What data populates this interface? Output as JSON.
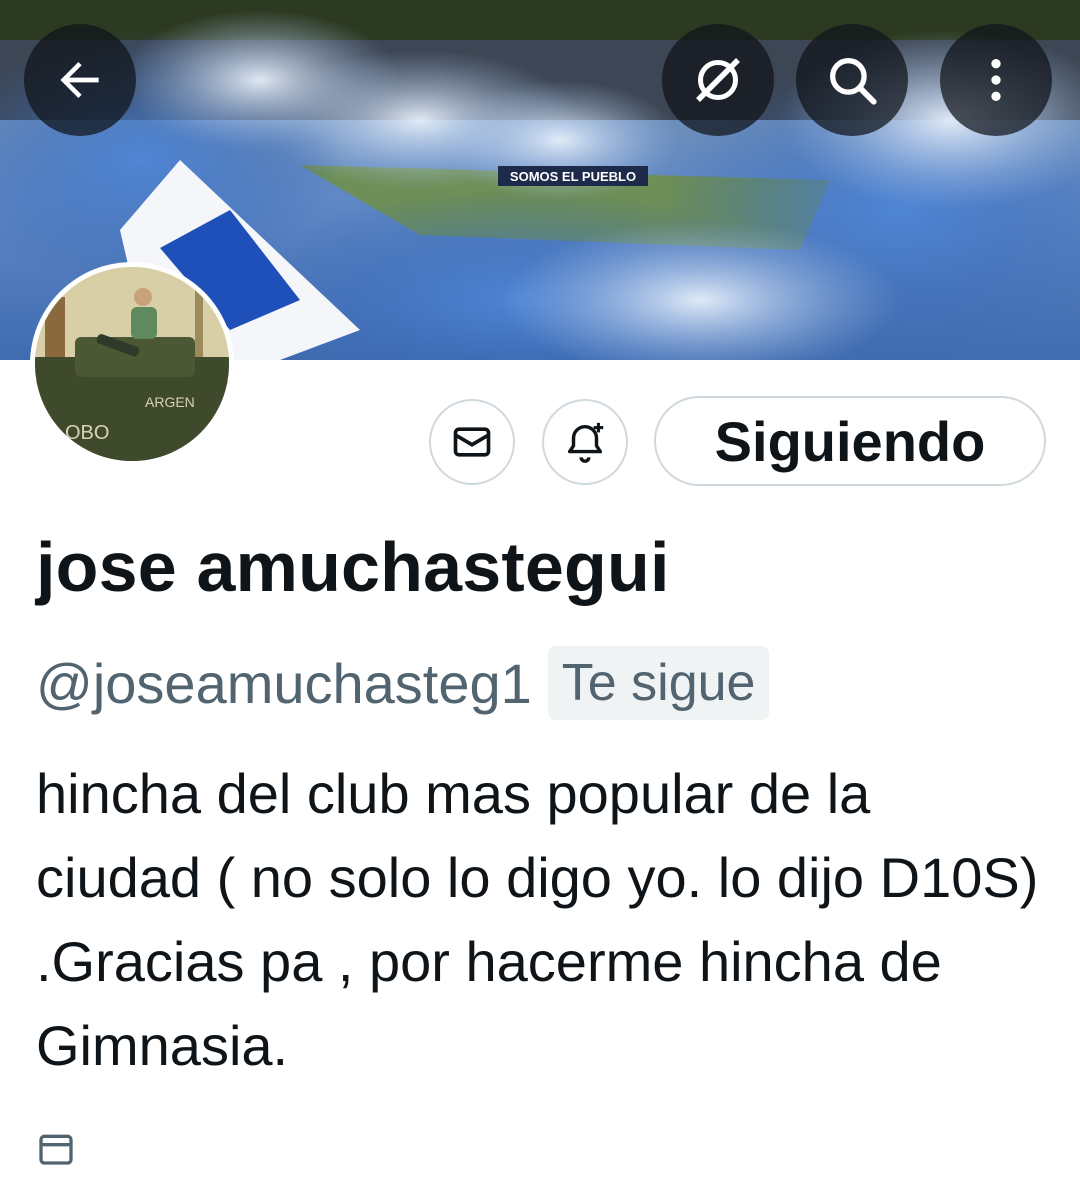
{
  "header": {
    "back_icon": "arrow-left-icon",
    "grok_icon": "grok-icon",
    "search_icon": "search-icon",
    "more_icon": "more-vertical-icon",
    "banner_sign_text": "SOMOS EL PUEBLO"
  },
  "actions": {
    "message_icon": "envelope-icon",
    "notify_icon": "bell-plus-icon",
    "follow_label": "Siguiendo"
  },
  "profile": {
    "display_name": "jose amuchastegui",
    "handle": "@joseamuchasteg1",
    "follows_you": "Te sigue",
    "bio": "hincha del club mas popular de la ciudad ( no solo lo digo yo. lo dijo D10S) .Gracias pa , por hacerme hincha de Gimnasia.",
    "joined_icon": "calendar-icon"
  },
  "colors": {
    "text_primary": "#0f1419",
    "text_secondary": "#536471",
    "border": "#cfd9de",
    "chip_bg": "#eff3f4",
    "header_button_bg": "#0f1419"
  }
}
